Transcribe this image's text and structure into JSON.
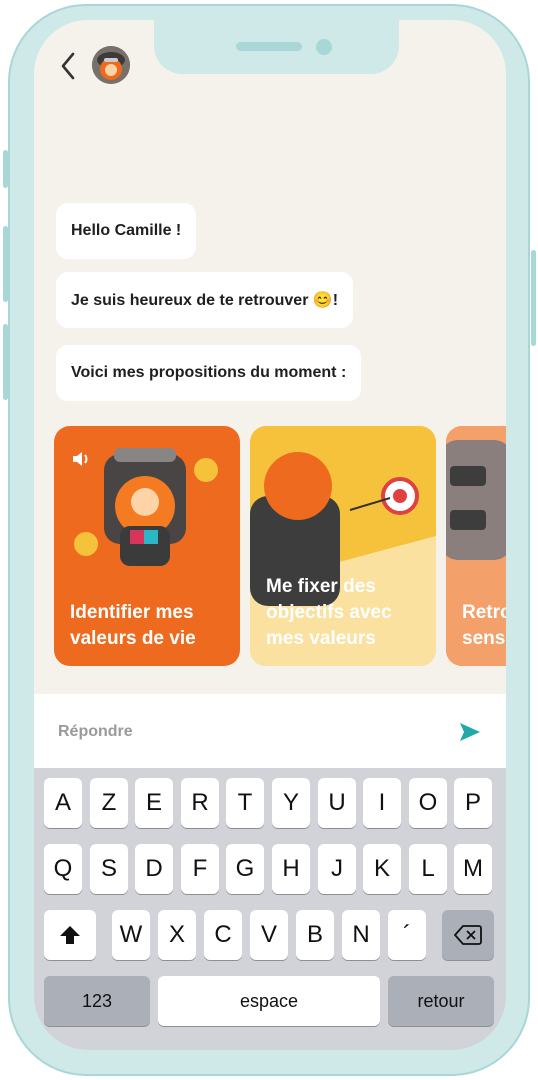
{
  "chat": {
    "messages": [
      {
        "text": "Hello Camille !"
      },
      {
        "text": "Je suis heureux de te retrouver 😊!"
      },
      {
        "text": "Voici mes propositions du moment :"
      }
    ]
  },
  "cards": [
    {
      "title": "Identifier mes valeurs de vie",
      "color": "#ee6a1f"
    },
    {
      "title": "Me fixer des objectifs avec mes valeurs",
      "color": "#f7c23b"
    },
    {
      "title": "Retrouver du sens dans ma vie",
      "color": "#f08a3c"
    }
  ],
  "reply": {
    "placeholder": "Répondre"
  },
  "keyboard": {
    "row1": [
      "A",
      "Z",
      "E",
      "R",
      "T",
      "Y",
      "U",
      "I",
      "O",
      "P"
    ],
    "row2": [
      "Q",
      "S",
      "D",
      "F",
      "G",
      "H",
      "J",
      "K",
      "L",
      "M"
    ],
    "row3": [
      "W",
      "X",
      "C",
      "V",
      "B",
      "N",
      "´"
    ],
    "numbers_label": "123",
    "space_label": "espace",
    "return_label": "retour"
  },
  "colors": {
    "accent": "#1fa9a9",
    "frame": "#cfe9e9",
    "orange": "#ee6a1f",
    "yellow": "#f7c23b"
  }
}
